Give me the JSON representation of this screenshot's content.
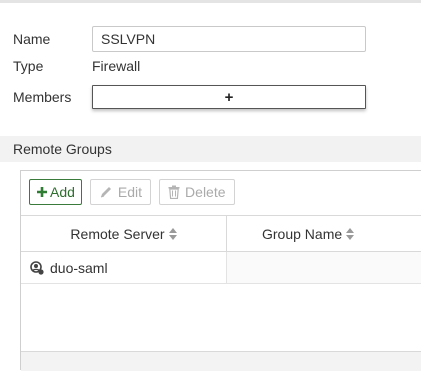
{
  "form": {
    "name_label": "Name",
    "name_value": "SSLVPN",
    "type_label": "Type",
    "type_value": "Firewall",
    "members_label": "Members",
    "members_add_symbol": "+"
  },
  "remote_groups": {
    "title": "Remote Groups",
    "toolbar": {
      "add_label": "Add",
      "edit_label": "Edit",
      "delete_label": "Delete"
    },
    "columns": [
      "Remote Server",
      "Group Name"
    ],
    "rows": [
      {
        "remote_server": "duo-saml",
        "group_name": ""
      }
    ]
  },
  "colors": {
    "accent_green": "#2e7d32",
    "disabled_text": "#aaaaaa",
    "section_bg": "#f2f2f2"
  },
  "icons": {
    "add": "plus-icon",
    "edit": "pencil-icon",
    "delete": "trash-icon",
    "sort": "sort-icon",
    "server": "saml-server-icon"
  }
}
